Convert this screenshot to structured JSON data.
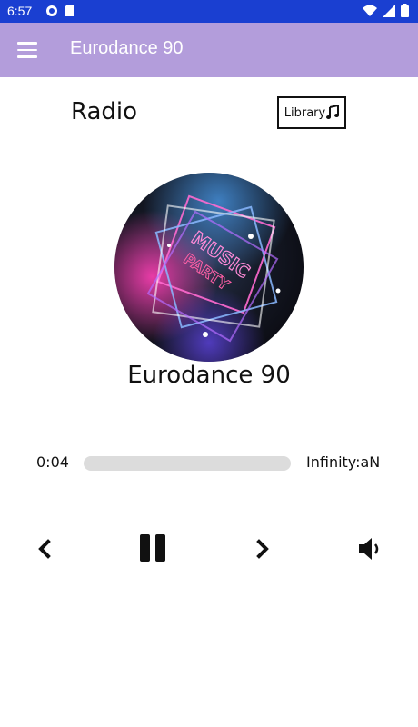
{
  "status_bar": {
    "time": "6:57"
  },
  "app_bar": {
    "title": "Eurodance 90",
    "menu_icon": "hamburger-menu-icon"
  },
  "header": {
    "title": "Radio",
    "library_label": "Library",
    "library_icon": "music-note-icon"
  },
  "now_playing": {
    "station_name": "Eurodance 90",
    "artwork_text": [
      "MUSIC",
      "PARTY"
    ],
    "artwork_colors": {
      "glow_pink": "#ff3fb4",
      "glow_blue": "#4f8cff",
      "glow_white": "#ffffff",
      "bg": "#101018"
    }
  },
  "progress": {
    "elapsed": "0:04",
    "total": "Infinity:aN",
    "fraction": 0
  },
  "controls": {
    "prev_icon": "chevron-left-icon",
    "pause_icon": "pause-icon",
    "next_icon": "chevron-right-icon",
    "volume_icon": "volume-icon"
  },
  "colors": {
    "status_bar": "#1a3fd1",
    "app_bar": "#b39ddb",
    "track": "#dcdcdc"
  }
}
